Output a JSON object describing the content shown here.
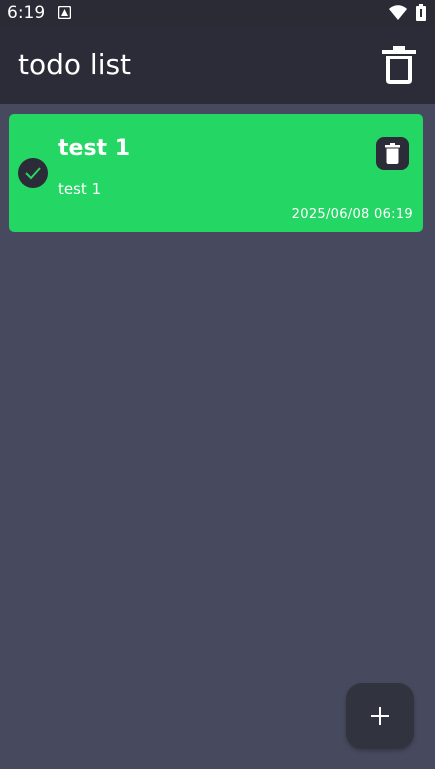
{
  "status_bar": {
    "time": "6:19"
  },
  "app_bar": {
    "title": "todo list",
    "delete_all_icon": "trash-icon"
  },
  "todos": [
    {
      "title": "test 1",
      "description": "test 1",
      "date": "2025/06/08 06:19",
      "completed": true,
      "status_color": "#24d664"
    }
  ],
  "fab": {
    "icon": "plus-icon"
  },
  "colors": {
    "background": "#474a5e",
    "app_bar": "#2b2c37",
    "card_done": "#24d664",
    "accent": "#24d664"
  }
}
